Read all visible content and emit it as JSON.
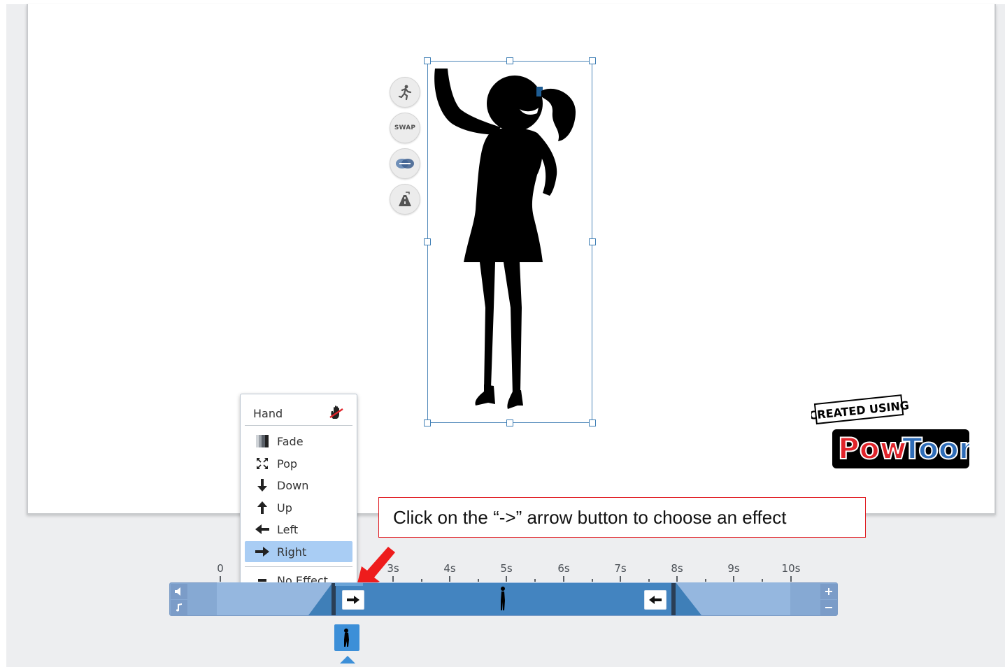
{
  "side_tools": {
    "swap_label": "SWAP"
  },
  "effect_menu": {
    "header": "Hand",
    "items": [
      {
        "label": "Fade",
        "icon": "fade-icon"
      },
      {
        "label": "Pop",
        "icon": "pop-icon"
      },
      {
        "label": "Down",
        "icon": "arrow-down-icon"
      },
      {
        "label": "Up",
        "icon": "arrow-up-icon"
      },
      {
        "label": "Left",
        "icon": "arrow-left-icon"
      },
      {
        "label": "Right",
        "icon": "arrow-right-icon"
      },
      {
        "label": "No Effect",
        "icon": "minus-icon"
      }
    ],
    "selected": "Right"
  },
  "callout": {
    "text": "Click on the “->” arrow button to choose an effect"
  },
  "timeline": {
    "ticks": [
      "0",
      "3s",
      "4s",
      "5s",
      "6s",
      "7s",
      "8s",
      "9s",
      "10s"
    ]
  },
  "colors": {
    "accent": "#3c8fd8",
    "selected_item": "#a9cdf4",
    "callout_border": "#e0191f"
  }
}
